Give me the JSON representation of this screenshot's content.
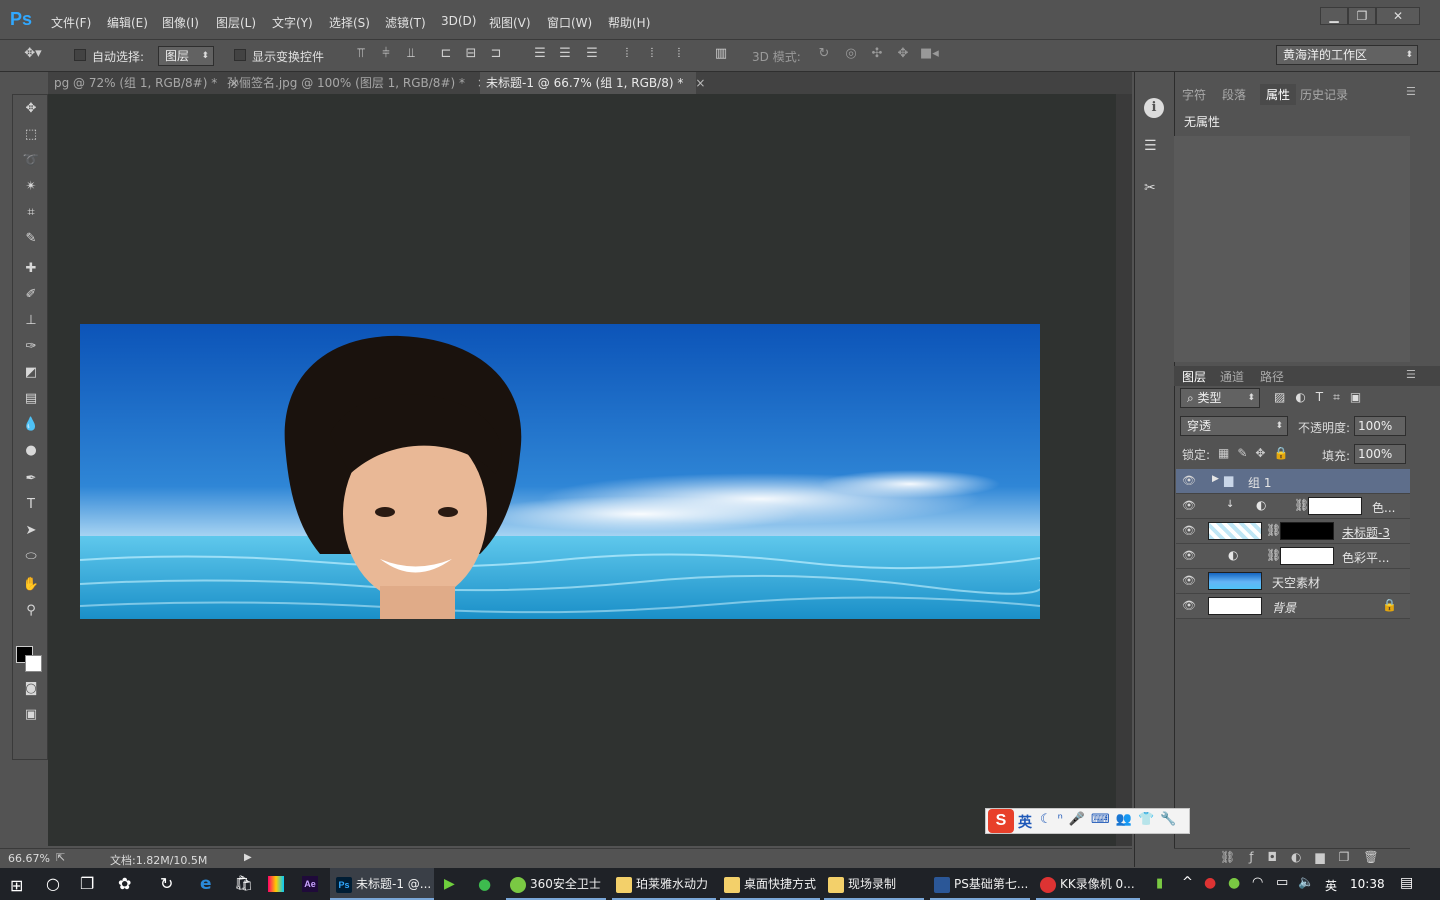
{
  "app": {
    "logo": "Ps"
  },
  "menu": [
    "文件(F)",
    "编辑(E)",
    "图像(I)",
    "图层(L)",
    "文字(Y)",
    "选择(S)",
    "滤镜(T)",
    "3D(D)",
    "视图(V)",
    "窗口(W)",
    "帮助(H)"
  ],
  "window_controls": {
    "minimize": "▁",
    "maximize": "❐",
    "close": "✕"
  },
  "options": {
    "auto_select_label": "自动选择:",
    "auto_select_value": "图层",
    "show_transform_label": "显示变换控件",
    "mode_3d_label": "3D 模式:",
    "workspace": "黄海洋的工作区"
  },
  "doc_tabs": [
    {
      "label": "pg @ 72% (组 1, RGB/8#) *",
      "close": "×",
      "active": false
    },
    {
      "label": "孙俪签名.jpg @ 100% (图层 1, RGB/8#) *",
      "close": "×",
      "active": false
    },
    {
      "label": "未标题-1 @ 66.7% (组 1, RGB/8) *",
      "close": "×",
      "active": true
    }
  ],
  "status": {
    "zoom": "66.67%",
    "doc": "文档:1.82M/10.5M"
  },
  "props_panel": {
    "tabs": [
      "字符",
      "段落",
      "属性",
      "历史记录"
    ],
    "active": "属性",
    "body": "无属性"
  },
  "layers_panel": {
    "tabs": [
      "图层",
      "通道",
      "路径"
    ],
    "filter": "类型",
    "blend_mode": "穿透",
    "opacity_label": "不透明度:",
    "opacity": "100%",
    "lock_label": "锁定:",
    "fill_label": "填充:",
    "fill": "100%",
    "layers": [
      {
        "name": "组 1"
      },
      {
        "name": "色..."
      },
      {
        "name": "未标题-3"
      },
      {
        "name": "色彩平..."
      },
      {
        "name": "天空素材"
      },
      {
        "name": "背景"
      }
    ]
  },
  "ime": {
    "mode": "英"
  },
  "taskbar": {
    "items": [
      "未标题-1 @...",
      "360安全卫士",
      "珀莱雅水动力",
      "桌面快捷方式",
      "现场录制",
      "PS基础第七...",
      "KK录像机 0..."
    ],
    "tray_lang": "英",
    "clock": "10:38"
  }
}
